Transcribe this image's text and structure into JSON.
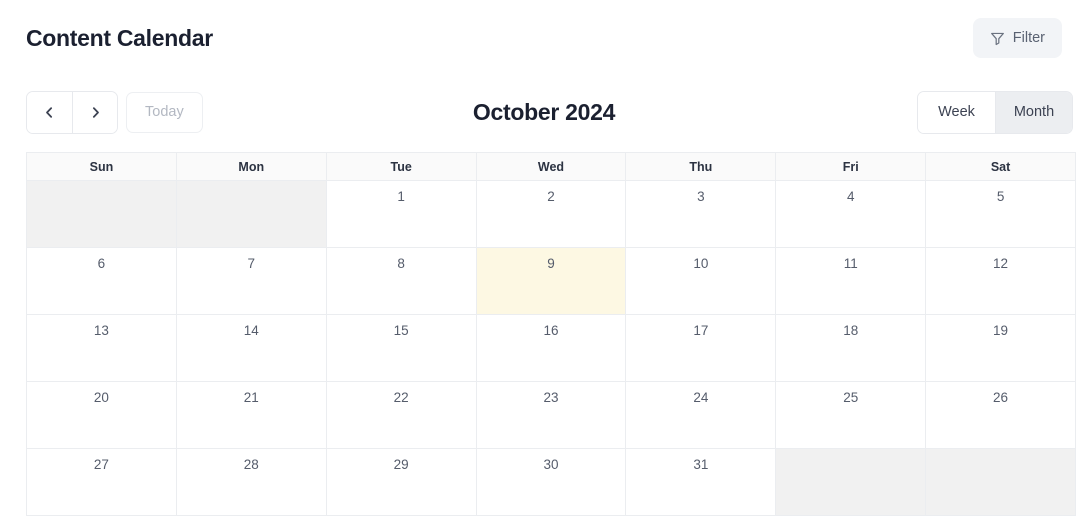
{
  "header": {
    "title": "Content Calendar",
    "filter_label": "Filter",
    "filter_icon": "funnel-icon",
    "filter_bg": "#f2f4f7"
  },
  "toolbar": {
    "prev_icon": "chevron-left-icon",
    "next_icon": "chevron-right-icon",
    "today_label": "Today",
    "month_title": "October 2024",
    "views": [
      {
        "label": "Week",
        "active": false
      },
      {
        "label": "Month",
        "active": true
      }
    ]
  },
  "calendar": {
    "weekdays": [
      "Sun",
      "Mon",
      "Tue",
      "Wed",
      "Thu",
      "Fri",
      "Sat"
    ],
    "today_bg": "#fdf8e3",
    "muted_bg": "#f1f1f1",
    "weeks": [
      [
        {
          "day": "",
          "state": "muted"
        },
        {
          "day": "",
          "state": "muted"
        },
        {
          "day": "1",
          "state": "normal"
        },
        {
          "day": "2",
          "state": "normal"
        },
        {
          "day": "3",
          "state": "normal"
        },
        {
          "day": "4",
          "state": "normal"
        },
        {
          "day": "5",
          "state": "normal"
        }
      ],
      [
        {
          "day": "6",
          "state": "normal"
        },
        {
          "day": "7",
          "state": "normal"
        },
        {
          "day": "8",
          "state": "normal"
        },
        {
          "day": "9",
          "state": "today"
        },
        {
          "day": "10",
          "state": "normal"
        },
        {
          "day": "11",
          "state": "normal"
        },
        {
          "day": "12",
          "state": "normal"
        }
      ],
      [
        {
          "day": "13",
          "state": "normal"
        },
        {
          "day": "14",
          "state": "normal"
        },
        {
          "day": "15",
          "state": "normal"
        },
        {
          "day": "16",
          "state": "normal"
        },
        {
          "day": "17",
          "state": "normal"
        },
        {
          "day": "18",
          "state": "normal"
        },
        {
          "day": "19",
          "state": "normal"
        }
      ],
      [
        {
          "day": "20",
          "state": "normal"
        },
        {
          "day": "21",
          "state": "normal"
        },
        {
          "day": "22",
          "state": "normal"
        },
        {
          "day": "23",
          "state": "normal"
        },
        {
          "day": "24",
          "state": "normal"
        },
        {
          "day": "25",
          "state": "normal"
        },
        {
          "day": "26",
          "state": "normal"
        }
      ],
      [
        {
          "day": "27",
          "state": "normal"
        },
        {
          "day": "28",
          "state": "normal"
        },
        {
          "day": "29",
          "state": "normal"
        },
        {
          "day": "30",
          "state": "normal"
        },
        {
          "day": "31",
          "state": "normal"
        },
        {
          "day": "",
          "state": "muted"
        },
        {
          "day": "",
          "state": "muted"
        }
      ]
    ]
  }
}
